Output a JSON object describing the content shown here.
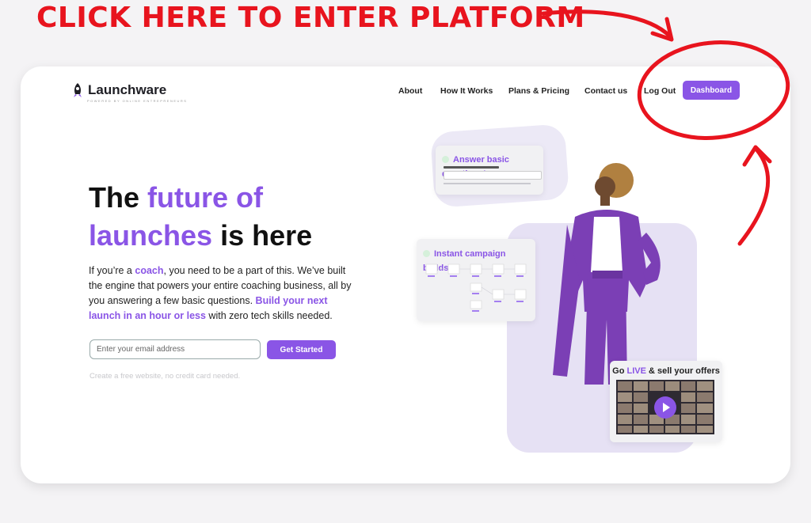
{
  "annotation": {
    "text": "CLICK HERE TO ENTER PLATFORM",
    "color": "#e8141e"
  },
  "header": {
    "logo_text": "Launchware",
    "logo_tagline": "POWERED BY ONLINE ENTREPRENEURS",
    "nav": [
      "About",
      "How It Works",
      "Plans & Pricing",
      "Contact us",
      "Log Out"
    ],
    "dashboard_label": "Dashboard"
  },
  "hero": {
    "title_plain_1": "The ",
    "title_accent_1": "future of",
    "title_accent_2": "launches",
    "title_plain_2": " is here",
    "body_1": "If you’re a ",
    "body_accent_1": "coach",
    "body_2": ", you need to be a part of this. We’ve built the engine that powers your entire coaching business, all by you answering a few basic questions. ",
    "body_accent_2": "Build your next launch in an hour or less",
    "body_3": " with zero tech skills needed.",
    "email_placeholder": "Enter your email address",
    "cta_label": "Get Started",
    "fine_print": "Create a free website, no credit card needed."
  },
  "panels": {
    "questions_title": "Answer basic questions!",
    "campaign_title": "Instant campaign builds!",
    "offers_prefix": "Go ",
    "offers_accent": "LIVE",
    "offers_suffix": " & sell your offers"
  },
  "colors": {
    "accent": "#8a55e6",
    "annotation_red": "#e8141e"
  }
}
